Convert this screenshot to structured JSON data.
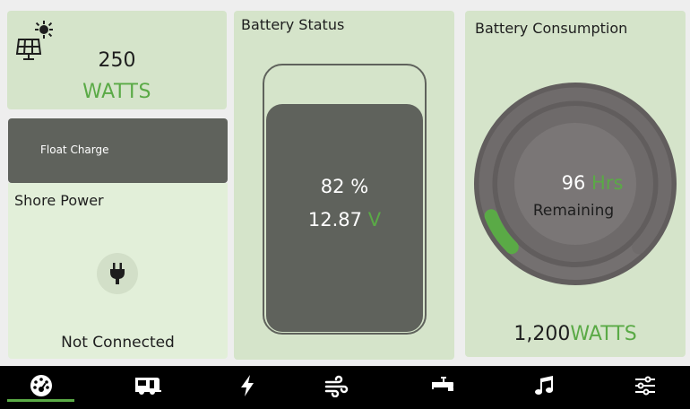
{
  "solar": {
    "value": "250",
    "unit": "WATTS",
    "icon": "solar-panel-icon"
  },
  "charge": {
    "label": "Float Charge"
  },
  "shore": {
    "title": "Shore Power",
    "status": "Not Connected",
    "icon": "plug-icon"
  },
  "battery": {
    "title": "Battery Status",
    "percent": "82",
    "percent_unit": "%",
    "voltage": "12.87",
    "voltage_unit": "V",
    "level": 0.82
  },
  "consumption": {
    "title": "Battery Consumption",
    "hours": "96",
    "hours_unit": "Hrs",
    "remaining_label": "Remaining",
    "watts": "1,200",
    "watts_unit": "WATTS"
  },
  "nav": {
    "items": [
      {
        "icon": "dashboard-icon",
        "active": true
      },
      {
        "icon": "camper-icon",
        "active": false
      },
      {
        "icon": "lightning-icon",
        "active": false
      },
      {
        "icon": "wind-icon",
        "active": false
      },
      {
        "icon": "faucet-icon",
        "active": false
      },
      {
        "icon": "music-icon",
        "active": false
      },
      {
        "icon": "sliders-icon",
        "active": false
      }
    ]
  },
  "colors": {
    "accent": "#5aaa46",
    "panel": "#d5e4ca",
    "dark": "#5f625c",
    "nav_bg": "#000000"
  }
}
